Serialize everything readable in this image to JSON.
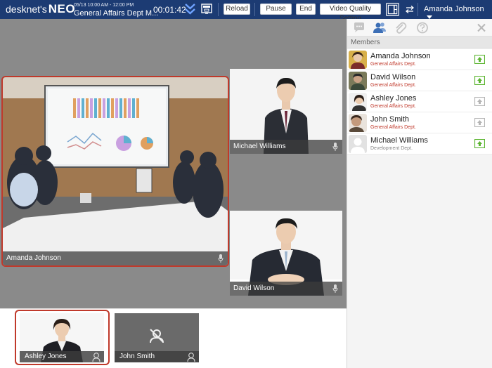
{
  "header": {
    "logo_prefix": "desknet's",
    "logo_suffix": "NEO",
    "meeting_time": "05/13 10:00 AM - 12:00 PM",
    "meeting_title": "General Affairs Dept M...",
    "elapsed": "00:01:42",
    "reload_label": "Reload",
    "pause_label": "Pause",
    "end_label": "End",
    "quality_label": "Video Quality Setting",
    "user_name": "Amanda Johnson"
  },
  "stage": {
    "main_video": {
      "name": "Amanda Johnson"
    },
    "videos": [
      {
        "name": "Michael Williams"
      },
      {
        "name": "David Wilson"
      }
    ]
  },
  "thumbnails": [
    {
      "name": "Ashley Jones"
    },
    {
      "name": "John Smith"
    }
  ],
  "sidebar": {
    "tabs": [
      "chat-icon",
      "members-icon",
      "attachment-icon",
      "help-icon",
      "close-icon"
    ],
    "members_header": "Members",
    "members": [
      {
        "name": "Amanda Johnson",
        "dept": "General Affairs Dept.",
        "status": "active"
      },
      {
        "name": "David Wilson",
        "dept": "General Affairs Dept.",
        "status": "active"
      },
      {
        "name": "Ashley Jones",
        "dept": "General Affairs Dept.",
        "status": "inactive"
      },
      {
        "name": "John Smith",
        "dept": "General Affairs Dept.",
        "status": "inactive"
      },
      {
        "name": "Michael Williams",
        "dept": "Development Dept.",
        "status": "active"
      }
    ]
  },
  "colors": {
    "topbar": "#1c3b73",
    "active_border": "#c0392b",
    "status_active": "#5cb531",
    "status_inactive": "#b5b5b5",
    "dept_text": "#c0392b"
  }
}
